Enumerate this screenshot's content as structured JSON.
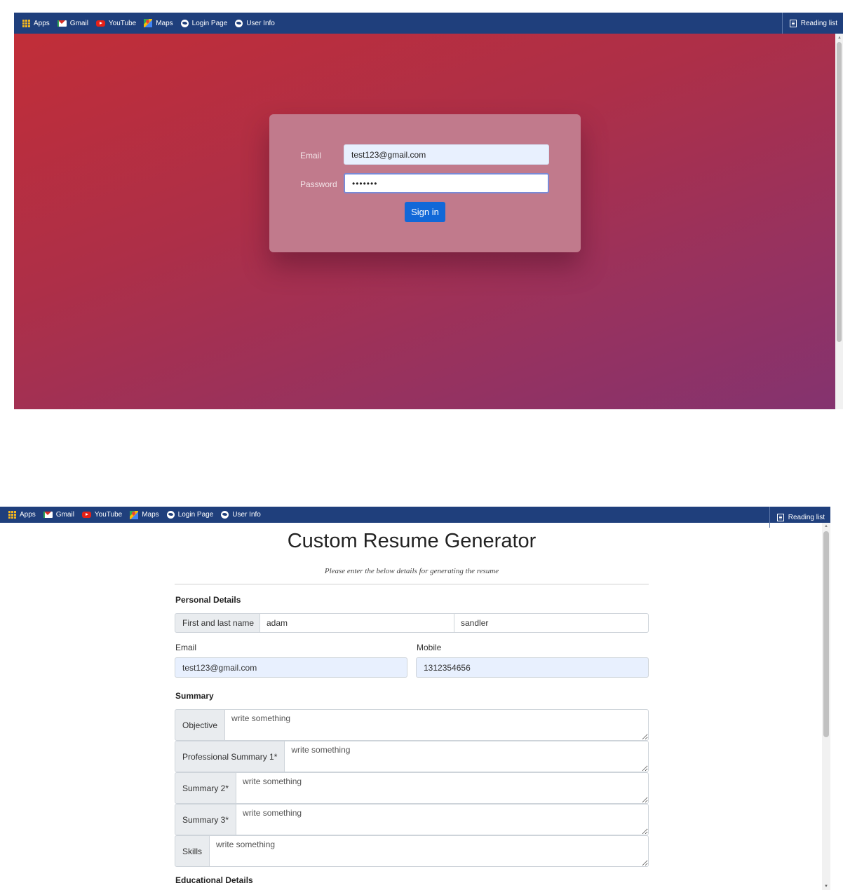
{
  "bookmarks": {
    "apps": "Apps",
    "gmail": "Gmail",
    "youtube": "YouTube",
    "maps": "Maps",
    "login_page": "Login Page",
    "user_info": "User Info",
    "reading_list": "Reading list"
  },
  "login": {
    "email_label": "Email",
    "email_value": "test123@gmail.com",
    "password_label": "Password",
    "password_value": "•••••••",
    "signin_label": "Sign in"
  },
  "resume": {
    "title": "Custom Resume Generator",
    "subtitle": "Please enter the below details for generating the resume",
    "personal_heading": "Personal Details",
    "name_label": "First and last name",
    "first_name": "adam",
    "last_name": "sandler",
    "email_label": "Email",
    "email_value": "test123@gmail.com",
    "mobile_label": "Mobile",
    "mobile_value": "1312354656",
    "summary_heading": "Summary",
    "summary_fields": [
      {
        "label": "Objective",
        "placeholder": "write something"
      },
      {
        "label": "Professional Summary 1*",
        "placeholder": "write something"
      },
      {
        "label": "Summary 2*",
        "placeholder": "write something"
      },
      {
        "label": "Summary 3*",
        "placeholder": "write something"
      },
      {
        "label": "Skills",
        "placeholder": "write something"
      }
    ],
    "education_heading": "Educational Details"
  }
}
